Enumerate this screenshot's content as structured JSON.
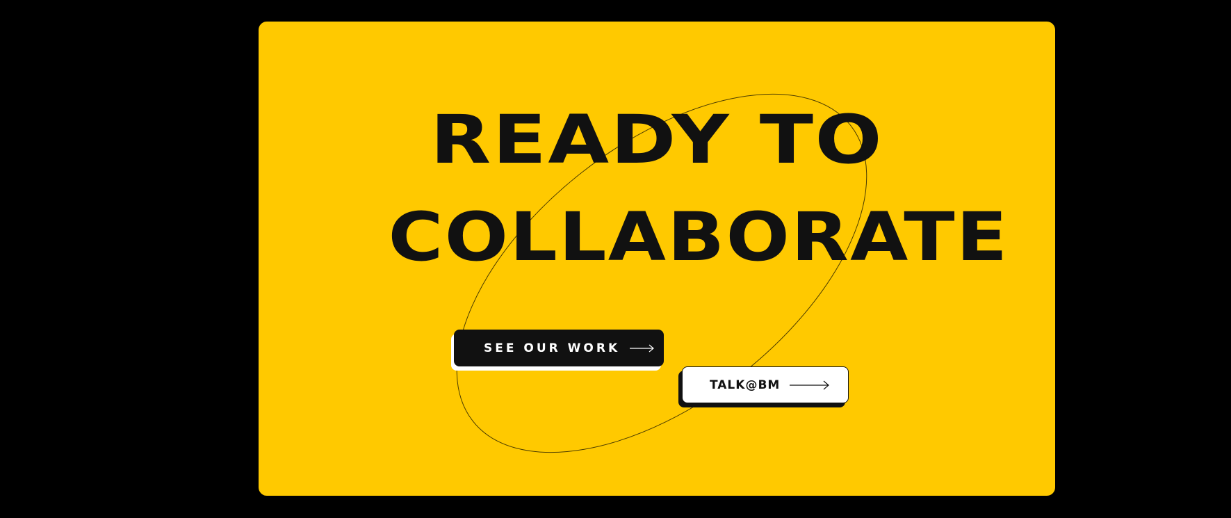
{
  "hero": {
    "headline_line1": "READY TO",
    "headline_line2": "COLLABORATE"
  },
  "buttons": {
    "see_work_label": "SEE OUR WORK",
    "talk_label": "TALK@BM",
    "arrow_icon": "arrow-right-icon"
  },
  "colors": {
    "page_background": "#000000",
    "card_background": "#FFC900",
    "text_dark": "#111111",
    "button_light": "#FFFFFF"
  }
}
